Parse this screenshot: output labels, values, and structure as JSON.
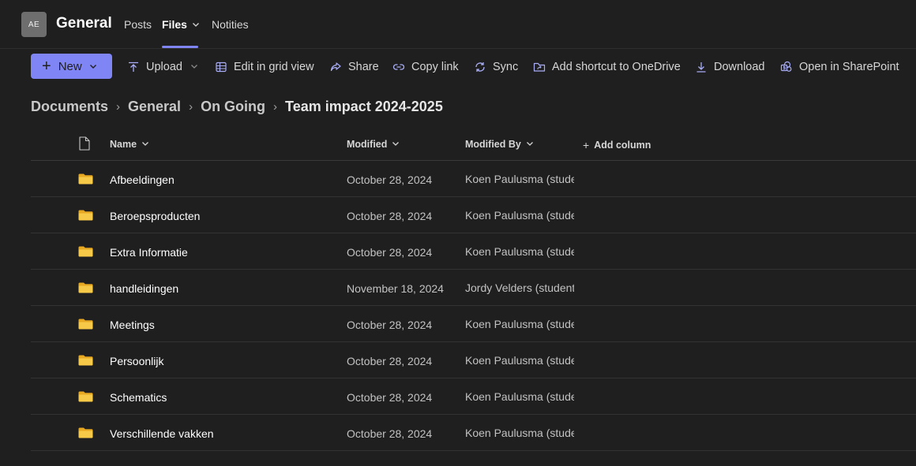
{
  "header": {
    "avatar_text": "AE",
    "channel_title": "General",
    "tabs": [
      {
        "label": "Posts"
      },
      {
        "label": "Files"
      },
      {
        "label": "Notities"
      }
    ]
  },
  "toolbar": {
    "new_label": "New",
    "upload_label": "Upload",
    "grid_label": "Edit in grid view",
    "share_label": "Share",
    "copy_link_label": "Copy link",
    "sync_label": "Sync",
    "shortcut_label": "Add shortcut to OneDrive",
    "download_label": "Download",
    "sharepoint_label": "Open in SharePoint"
  },
  "breadcrumb": {
    "items": [
      "Documents",
      "General",
      "On Going",
      "Team impact 2024-2025"
    ]
  },
  "table": {
    "columns": {
      "name": "Name",
      "modified": "Modified",
      "modified_by": "Modified By",
      "add_column": "Add column"
    },
    "rows": [
      {
        "name": "Afbeeldingen",
        "modified": "October 28, 2024",
        "modified_by": "Koen Paulusma (student)"
      },
      {
        "name": "Beroepsproducten",
        "modified": "October 28, 2024",
        "modified_by": "Koen Paulusma (student)"
      },
      {
        "name": "Extra Informatie",
        "modified": "October 28, 2024",
        "modified_by": "Koen Paulusma (student)"
      },
      {
        "name": "handleidingen",
        "modified": "November 18, 2024",
        "modified_by": "Jordy Velders (student)"
      },
      {
        "name": "Meetings",
        "modified": "October 28, 2024",
        "modified_by": "Koen Paulusma (student)"
      },
      {
        "name": "Persoonlijk",
        "modified": "October 28, 2024",
        "modified_by": "Koen Paulusma (student)"
      },
      {
        "name": "Schematics",
        "modified": "October 28, 2024",
        "modified_by": "Koen Paulusma (student)"
      },
      {
        "name": "Verschillende vakken",
        "modified": "October 28, 2024",
        "modified_by": "Koen Paulusma (student)"
      }
    ]
  },
  "colors": {
    "accent": "#7f85f5",
    "background": "#1f1f1f",
    "folder": "#f3c44f"
  }
}
